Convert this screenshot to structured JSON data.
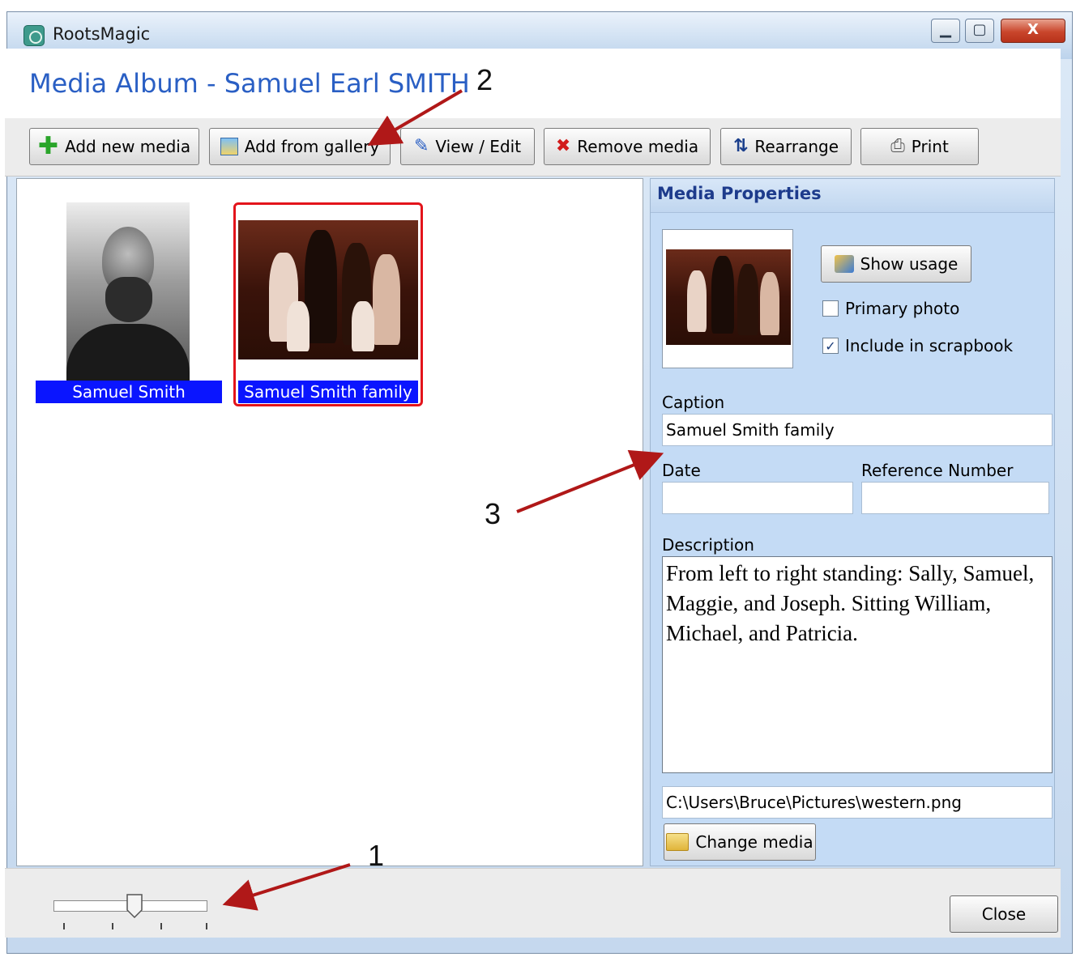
{
  "window": {
    "title": "RootsMagic",
    "controls": {
      "minimize": "▁",
      "maximize": "▢",
      "close": "X"
    }
  },
  "header": {
    "title": "Media Album - Samuel Earl SMITH"
  },
  "toolbar": {
    "buttons": [
      {
        "label": "Add new media",
        "icon": "plus-icon"
      },
      {
        "label": "Add from gallery",
        "icon": "gallery-icon"
      },
      {
        "label": "View / Edit",
        "icon": "edit-pencil-icon"
      },
      {
        "label": "Remove media",
        "icon": "remove-x-icon"
      },
      {
        "label": "Rearrange",
        "icon": "rearrange-arrows-icon"
      },
      {
        "label": "Print",
        "icon": "printer-icon"
      }
    ]
  },
  "gallery": {
    "items": [
      {
        "caption": "Samuel Smith",
        "selected": false
      },
      {
        "caption": "Samuel Smith family",
        "selected": true
      }
    ]
  },
  "properties": {
    "heading": "Media Properties",
    "show_usage": "Show usage",
    "primary_photo": {
      "label": "Primary photo",
      "checked": false
    },
    "include_scrapbook": {
      "label": "Include in scrapbook",
      "checked": true
    },
    "caption_label": "Caption",
    "caption_value": "Samuel Smith family",
    "date_label": "Date",
    "date_value": "",
    "reference_label": "Reference Number",
    "reference_value": "",
    "description_label": "Description",
    "description_value": "From left to right standing: Sally, Samuel, Maggie, and Joseph.  Sitting William, Michael, and Patricia.",
    "file_path": "C:\\Users\\Bruce\\Pictures\\western.png",
    "change_media": "Change media"
  },
  "footer": {
    "close": "Close",
    "zoom_level": 0.5
  },
  "callouts": [
    "1",
    "2",
    "3"
  ],
  "colors": {
    "accent": "#2a5fc4",
    "selection": "#0a15ff",
    "selected_border": "#e3141b",
    "arrow": "#b01818"
  }
}
